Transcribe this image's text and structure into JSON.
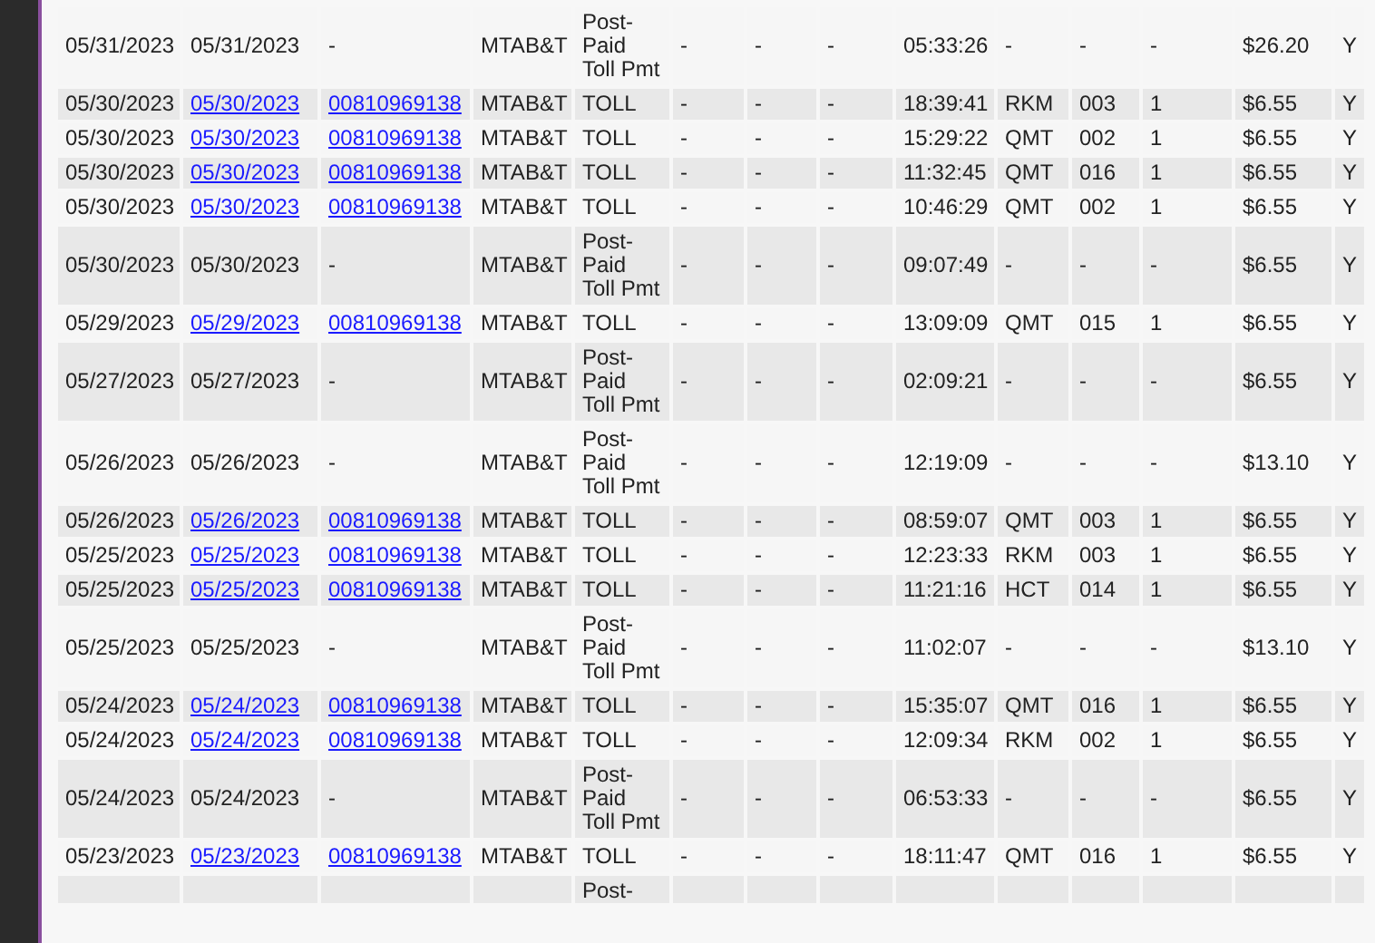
{
  "table": {
    "rows": [
      {
        "kind": "postpaid",
        "cells": [
          "05/31/2023",
          "05/31/2023",
          "-",
          "MTAB&T",
          "Post-Paid Toll Pmt",
          "-",
          "-",
          "-",
          "05:33:26",
          "-",
          "-",
          "-",
          "$26.20",
          "Y"
        ]
      },
      {
        "kind": "toll",
        "cells": [
          "05/30/2023",
          "05/30/2023",
          "00810969138",
          "MTAB&T",
          "TOLL",
          "-",
          "-",
          "-",
          "18:39:41",
          "RKM",
          "003",
          "1",
          "$6.55",
          "Y"
        ]
      },
      {
        "kind": "toll",
        "cells": [
          "05/30/2023",
          "05/30/2023",
          "00810969138",
          "MTAB&T",
          "TOLL",
          "-",
          "-",
          "-",
          "15:29:22",
          "QMT",
          "002",
          "1",
          "$6.55",
          "Y"
        ]
      },
      {
        "kind": "toll",
        "cells": [
          "05/30/2023",
          "05/30/2023",
          "00810969138",
          "MTAB&T",
          "TOLL",
          "-",
          "-",
          "-",
          "11:32:45",
          "QMT",
          "016",
          "1",
          "$6.55",
          "Y"
        ]
      },
      {
        "kind": "toll",
        "cells": [
          "05/30/2023",
          "05/30/2023",
          "00810969138",
          "MTAB&T",
          "TOLL",
          "-",
          "-",
          "-",
          "10:46:29",
          "QMT",
          "002",
          "1",
          "$6.55",
          "Y"
        ]
      },
      {
        "kind": "postpaid",
        "cells": [
          "05/30/2023",
          "05/30/2023",
          "-",
          "MTAB&T",
          "Post-Paid Toll Pmt",
          "-",
          "-",
          "-",
          "09:07:49",
          "-",
          "-",
          "-",
          "$6.55",
          "Y"
        ]
      },
      {
        "kind": "toll",
        "cells": [
          "05/29/2023",
          "05/29/2023",
          "00810969138",
          "MTAB&T",
          "TOLL",
          "-",
          "-",
          "-",
          "13:09:09",
          "QMT",
          "015",
          "1",
          "$6.55",
          "Y"
        ]
      },
      {
        "kind": "postpaid",
        "cells": [
          "05/27/2023",
          "05/27/2023",
          "-",
          "MTAB&T",
          "Post-Paid Toll Pmt",
          "-",
          "-",
          "-",
          "02:09:21",
          "-",
          "-",
          "-",
          "$6.55",
          "Y"
        ]
      },
      {
        "kind": "postpaid",
        "cells": [
          "05/26/2023",
          "05/26/2023",
          "-",
          "MTAB&T",
          "Post-Paid Toll Pmt",
          "-",
          "-",
          "-",
          "12:19:09",
          "-",
          "-",
          "-",
          "$13.10",
          "Y"
        ]
      },
      {
        "kind": "toll",
        "cells": [
          "05/26/2023",
          "05/26/2023",
          "00810969138",
          "MTAB&T",
          "TOLL",
          "-",
          "-",
          "-",
          "08:59:07",
          "QMT",
          "003",
          "1",
          "$6.55",
          "Y"
        ]
      },
      {
        "kind": "toll",
        "cells": [
          "05/25/2023",
          "05/25/2023",
          "00810969138",
          "MTAB&T",
          "TOLL",
          "-",
          "-",
          "-",
          "12:23:33",
          "RKM",
          "003",
          "1",
          "$6.55",
          "Y"
        ]
      },
      {
        "kind": "toll",
        "cells": [
          "05/25/2023",
          "05/25/2023",
          "00810969138",
          "MTAB&T",
          "TOLL",
          "-",
          "-",
          "-",
          "11:21:16",
          "HCT",
          "014",
          "1",
          "$6.55",
          "Y"
        ]
      },
      {
        "kind": "postpaid",
        "cells": [
          "05/25/2023",
          "05/25/2023",
          "-",
          "MTAB&T",
          "Post-Paid Toll Pmt",
          "-",
          "-",
          "-",
          "11:02:07",
          "-",
          "-",
          "-",
          "$13.10",
          "Y"
        ]
      },
      {
        "kind": "toll",
        "cells": [
          "05/24/2023",
          "05/24/2023",
          "00810969138",
          "MTAB&T",
          "TOLL",
          "-",
          "-",
          "-",
          "15:35:07",
          "QMT",
          "016",
          "1",
          "$6.55",
          "Y"
        ]
      },
      {
        "kind": "toll",
        "cells": [
          "05/24/2023",
          "05/24/2023",
          "00810969138",
          "MTAB&T",
          "TOLL",
          "-",
          "-",
          "-",
          "12:09:34",
          "RKM",
          "002",
          "1",
          "$6.55",
          "Y"
        ]
      },
      {
        "kind": "postpaid",
        "cells": [
          "05/24/2023",
          "05/24/2023",
          "-",
          "MTAB&T",
          "Post-Paid Toll Pmt",
          "-",
          "-",
          "-",
          "06:53:33",
          "-",
          "-",
          "-",
          "$6.55",
          "Y"
        ]
      },
      {
        "kind": "toll",
        "cells": [
          "05/23/2023",
          "05/23/2023",
          "00810969138",
          "MTAB&T",
          "TOLL",
          "-",
          "-",
          "-",
          "18:11:47",
          "QMT",
          "016",
          "1",
          "$6.55",
          "Y"
        ]
      },
      {
        "kind": "partial",
        "cells": [
          "",
          "",
          "",
          "",
          "Post-",
          "",
          "",
          "",
          "",
          "",
          "",
          "",
          "",
          ""
        ]
      }
    ]
  }
}
